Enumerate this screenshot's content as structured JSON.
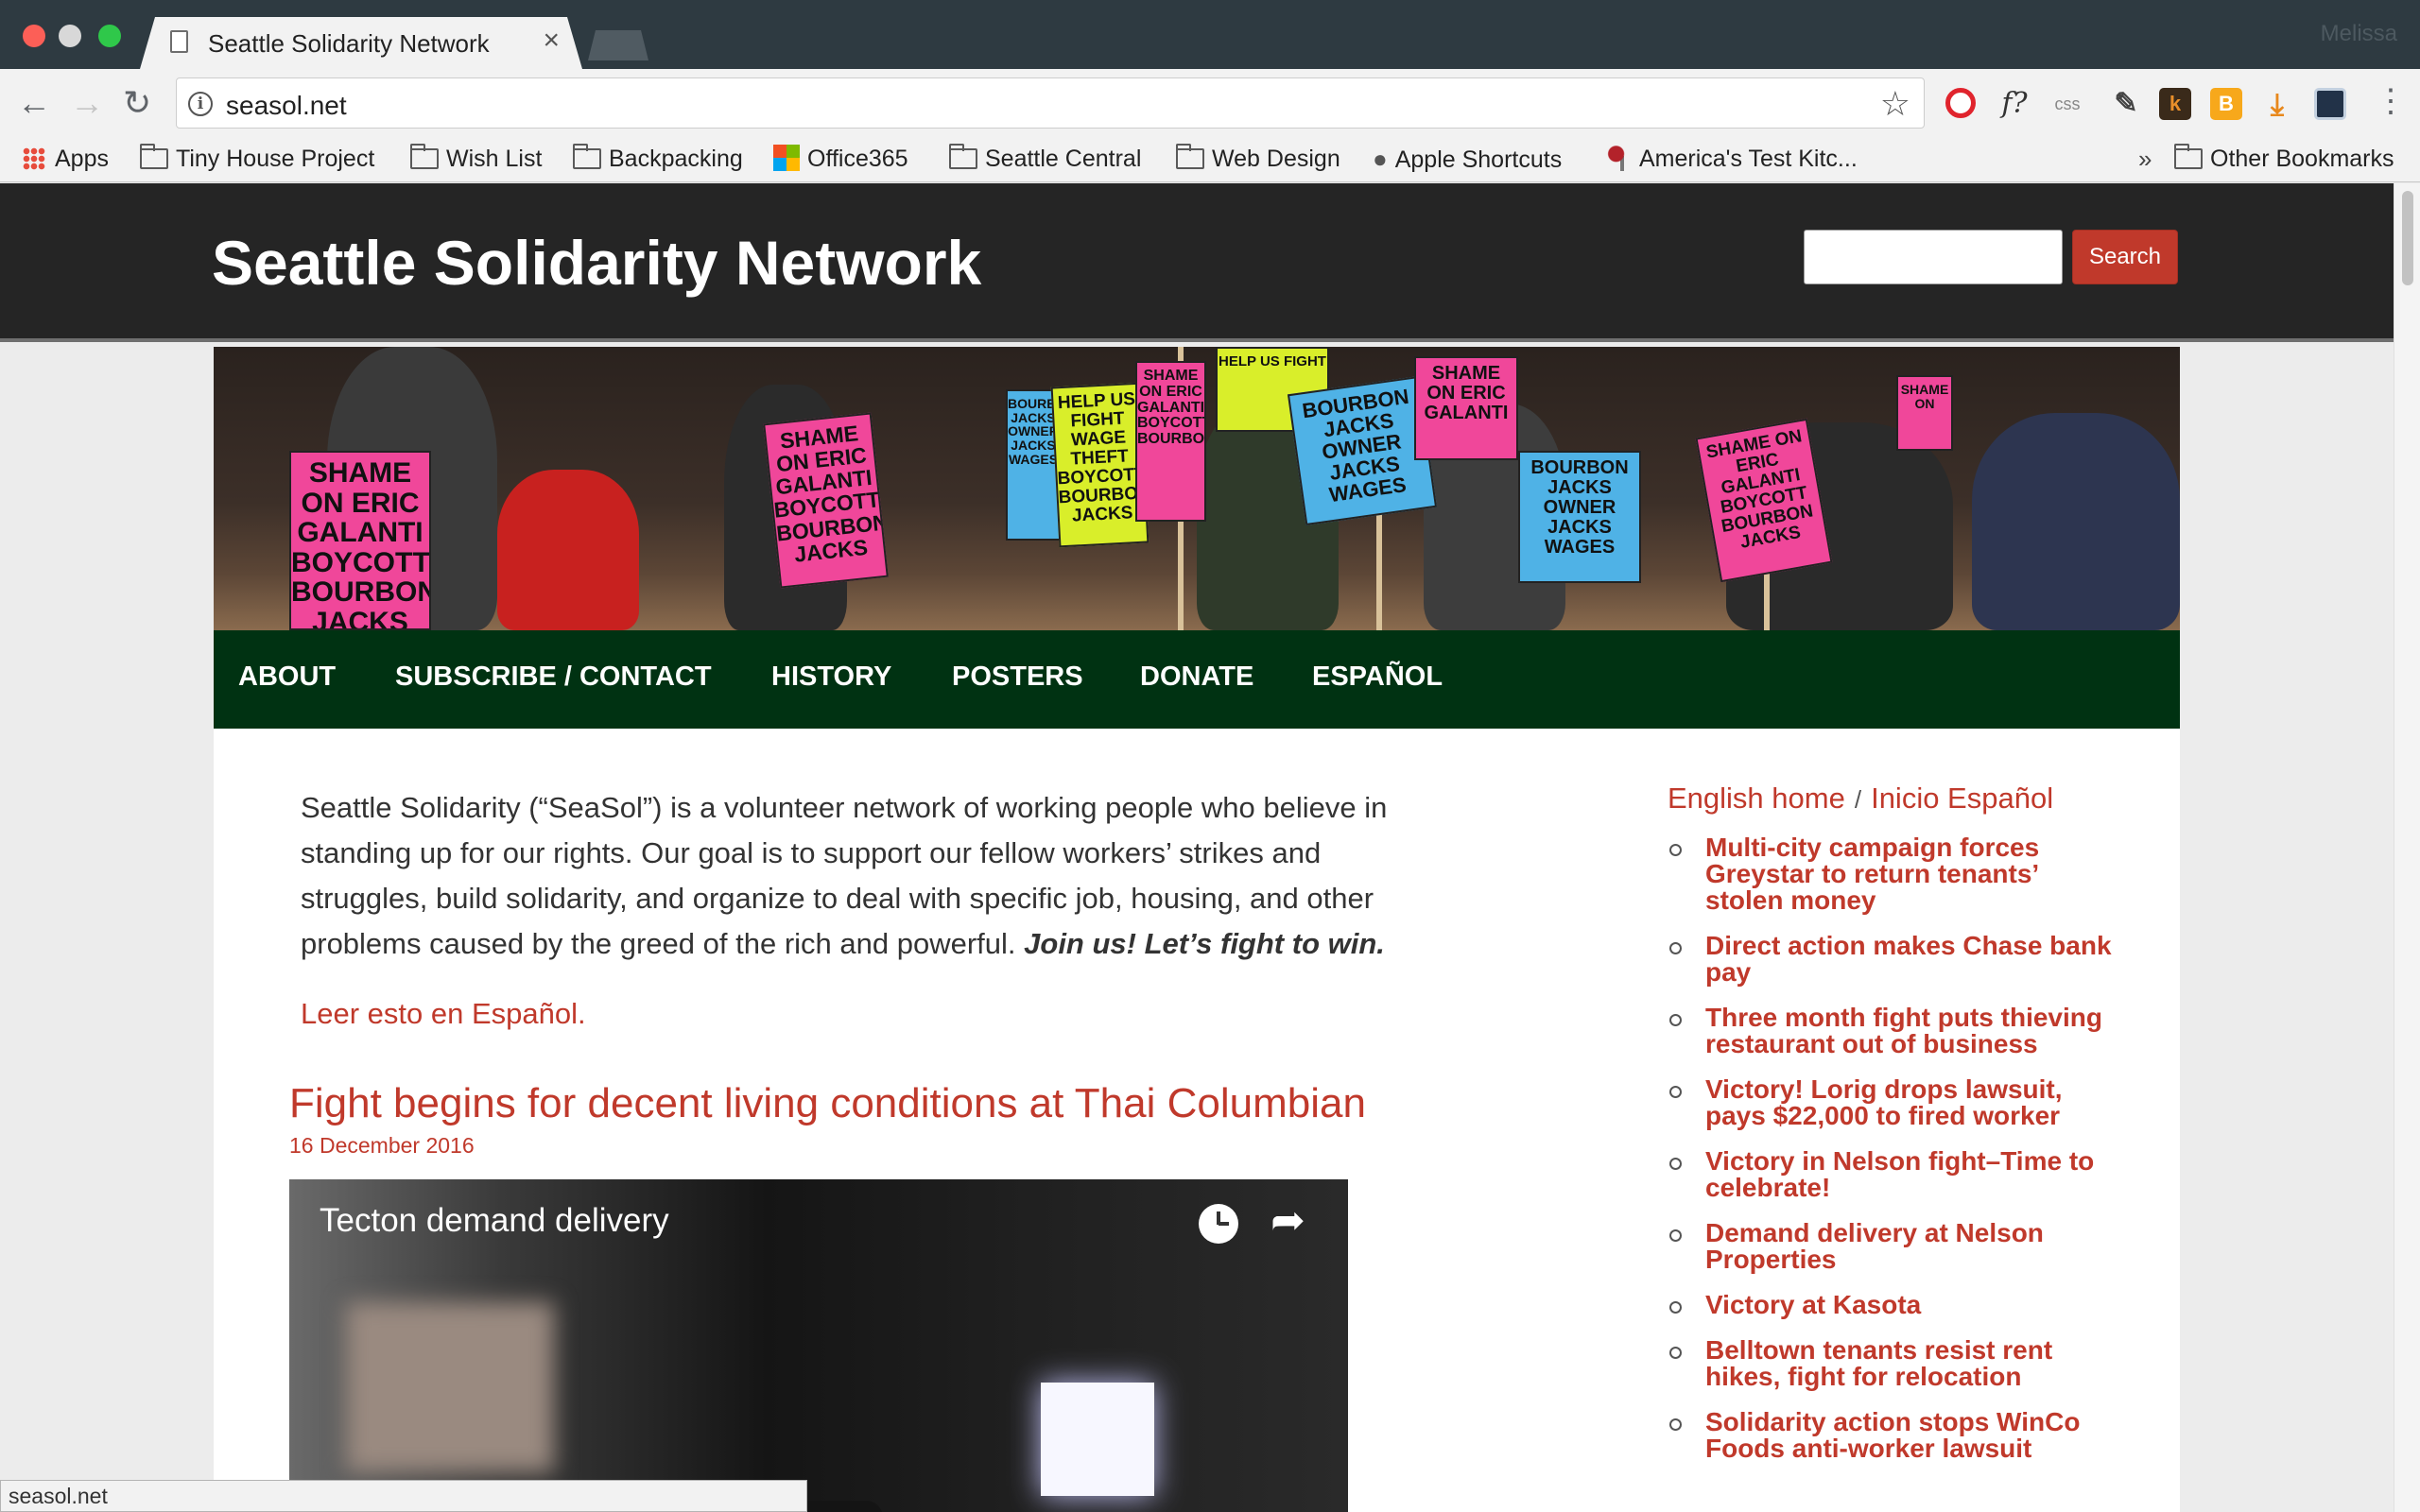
{
  "browser": {
    "tab_title": "Seattle Solidarity Network",
    "profile_name": "Melissa",
    "url": "seasol.net",
    "status_url": "seasol.net",
    "bookmarks": [
      {
        "label": "Apps",
        "icon": "apps-grid-icon"
      },
      {
        "label": "Tiny House Project",
        "icon": "folder-icon"
      },
      {
        "label": "Wish List",
        "icon": "folder-icon"
      },
      {
        "label": "Backpacking",
        "icon": "folder-icon"
      },
      {
        "label": "Office365",
        "icon": "office365-icon"
      },
      {
        "label": "Seattle Central",
        "icon": "folder-icon"
      },
      {
        "label": "Web Design",
        "icon": "folder-icon"
      },
      {
        "label": "Apple Shortcuts",
        "icon": "apple-icon"
      },
      {
        "label": "America's Test Kitc...",
        "icon": "test-kitchen-icon"
      }
    ],
    "bookmarks_overflow": "»",
    "other_bookmarks": "Other Bookmarks",
    "extensions": {
      "fq": "f?",
      "css": "css",
      "k": "k",
      "b": "B"
    }
  },
  "site": {
    "title": "Seattle Solidarity Network",
    "search_button": "Search",
    "nav": [
      "ABOUT",
      "SUBSCRIBE / CONTACT",
      "HISTORY",
      "POSTERS",
      "DONATE",
      "ESPAÑOL"
    ],
    "intro_text": "Seattle Solidarity (“SeaSol”) is a volunteer network of working people who believe in standing up for our rights. Our goal is to support our fellow workers’ strikes and struggles, build solidarity, and organize to deal with specific job, housing, and other problems caused by the greed of the rich and powerful.",
    "intro_emphasis": "Join us!  Let’s fight to win.",
    "spanish_link": "Leer esto en Español.",
    "post": {
      "title": "Fight begins for decent living conditions at Thai Columbian",
      "date": "16 December 2016",
      "video_title": "Tecton demand delivery"
    },
    "sidebar": {
      "home_en": "English home",
      "separator": "/",
      "home_es": "Inicio Español",
      "links": [
        "Multi-city campaign forces Greystar to return tenants’ stolen money",
        "Direct action makes Chase bank pay",
        "Three month fight puts thieving restaurant out of business",
        "Victory! Lorig drops lawsuit, pays $22,000 to fired worker",
        "Victory in Nelson fight–Time to celebrate!",
        "Demand delivery at Nelson Properties",
        "Victory at Kasota",
        "Belltown tenants resist rent hikes, fight for relocation",
        "Solidarity action stops WinCo Foods anti-worker lawsuit"
      ]
    },
    "banner_signs": [
      {
        "text": "SHAME ON ERIC GALANTI BOYCOTT BOURBON JACKS",
        "color": "#f0479a"
      },
      {
        "text": "SHAME ON ERIC GALANTI BOYCOTT BOURBON JACKS",
        "color": "#f0479a"
      },
      {
        "text": "BOURBON JACKS OWNER JACKS WAGES",
        "color": "#4fb2e6"
      },
      {
        "text": "HELP US FIGHT WAGE THEFT BOYCOTT BOURBON JACKS",
        "color": "#d9ee2a"
      },
      {
        "text": "SHAME ON ERIC GALANTI BOYCOTT BOURBON",
        "color": "#f0479a"
      },
      {
        "text": "HELP US FIGHT",
        "color": "#d9ee2a"
      },
      {
        "text": "BOURBON JACKS OWNER JACKS WAGES",
        "color": "#4fb2e6"
      },
      {
        "text": "SHAME ON ERIC GALANTI",
        "color": "#f0479a"
      },
      {
        "text": "BOURBON JACKS OWNER JACKS WAGES",
        "color": "#4fb2e6"
      },
      {
        "text": "SHAME ON ERIC GALANTI BOYCOTT BOURBON JACKS",
        "color": "#f0479a"
      },
      {
        "text": "SHAME ON",
        "color": "#f0479a"
      }
    ],
    "colors": {
      "accent": "#c0392b",
      "nav_bg": "#003212",
      "header_bg": "#252525"
    }
  }
}
